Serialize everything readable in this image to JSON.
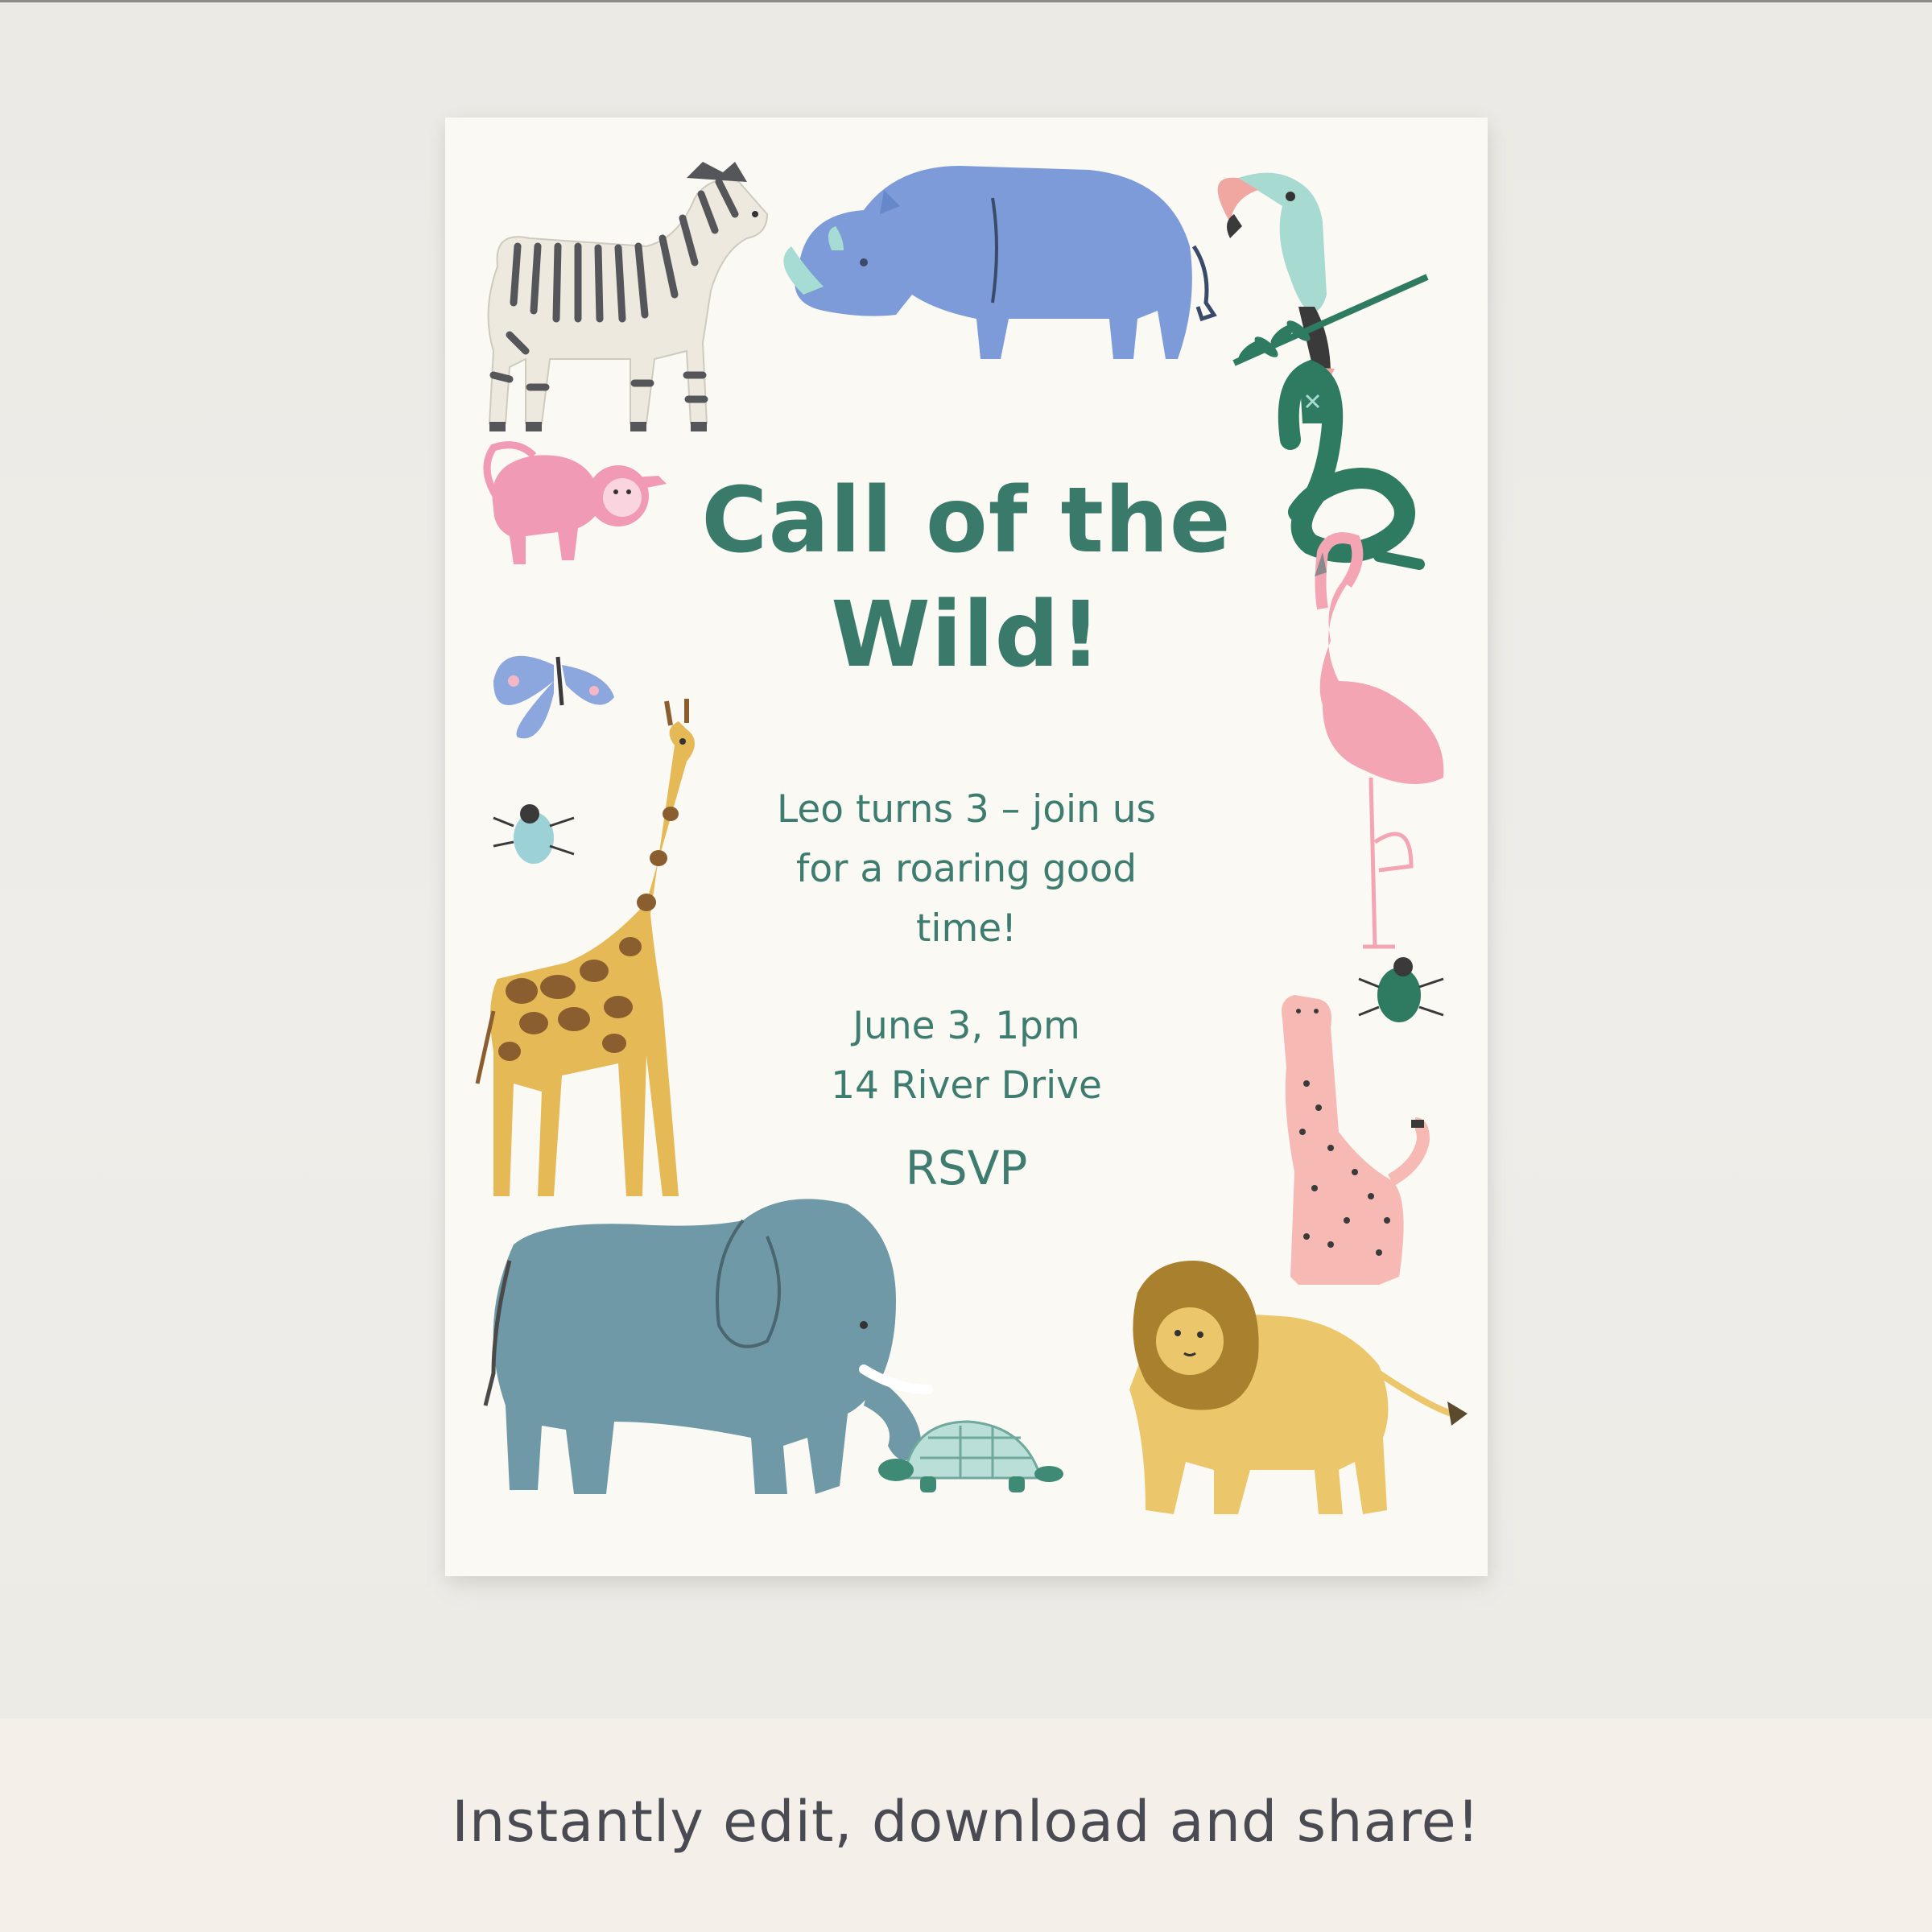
{
  "invitation": {
    "title_line1": "Call of the",
    "title_line2": "Wild!",
    "message_line1": "Leo turns 3 – join us",
    "message_line2": "for a roaring good",
    "message_line3": "time!",
    "date": "June 3, 1pm",
    "address": "14 River Drive",
    "rsvp": "RSVP"
  },
  "footer": {
    "tagline": "Instantly edit, download and share!"
  },
  "colors": {
    "text_green": "#3D7C6F",
    "card_background": "#FBF9F4",
    "footer_background": "#F4EFE9",
    "footer_text": "#4A4A52"
  },
  "illustrations": [
    "zebra-icon",
    "rhino-icon",
    "toucan-icon",
    "snake-icon",
    "monkey-icon",
    "butterfly-icon",
    "flamingo-icon",
    "beetle-icon",
    "giraffe-icon",
    "cheetah-icon",
    "elephant-icon",
    "turtle-icon",
    "lion-icon"
  ]
}
